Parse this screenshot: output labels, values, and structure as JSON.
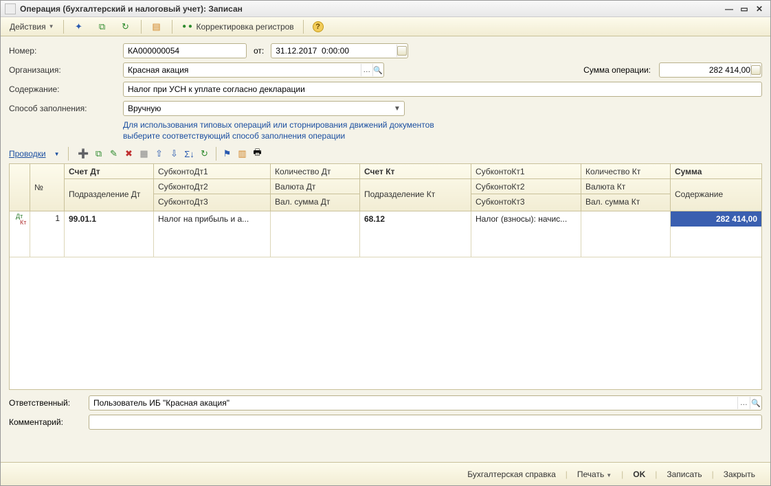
{
  "titlebar": {
    "title": "Операция (бухгалтерский и налоговый учет): Записан"
  },
  "toolbar": {
    "actions_label": "Действия",
    "reg_correction": "Корректировка регистров"
  },
  "form": {
    "number_label": "Номер:",
    "number_value": "КА000000054",
    "from_label": "от:",
    "date_value": "31.12.2017  0:00:00",
    "org_label": "Организация:",
    "org_value": "Красная акация",
    "sum_label": "Сумма операции:",
    "sum_value": "282 414,00",
    "content_label": "Содержание:",
    "content_value": "Налог при УСН к уплате согласно декларации",
    "fill_label": "Способ заполнения:",
    "fill_value": "Вручную",
    "hint_line1": "Для использования типовых операций или сторнирования движений документов",
    "hint_line2": "выберите соответствующий способ заполнения операции"
  },
  "tabs": {
    "entries": "Проводки"
  },
  "grid": {
    "headers": {
      "num": "№",
      "acc_dt": "Счет Дт",
      "dept_dt": "Подразделение Дт",
      "sub_dt1": "СубконтоДт1",
      "sub_dt2": "СубконтоДт2",
      "sub_dt3": "СубконтоДт3",
      "qty_dt": "Количество Дт",
      "cur_dt": "Валюта Дт",
      "cursum_dt": "Вал. сумма Дт",
      "acc_kt": "Счет Кт",
      "dept_kt": "Подразделение Кт",
      "sub_kt1": "СубконтоКт1",
      "sub_kt2": "СубконтоКт2",
      "sub_kt3": "СубконтоКт3",
      "qty_kt": "Количество Кт",
      "cur_kt": "Валюта Кт",
      "cursum_kt": "Вал. сумма Кт",
      "sum": "Сумма",
      "content": "Содержание"
    },
    "row1": {
      "num": "1",
      "acc_dt": "99.01.1",
      "sub_dt1": "Налог на прибыль и а...",
      "acc_kt": "68.12",
      "sub_kt1": "Налог (взносы): начис...",
      "sum": "282 414,00"
    },
    "dtkt": {
      "dt": "Дт",
      "kt": "Кт"
    }
  },
  "bottom": {
    "resp_label": "Ответственный:",
    "resp_value": "Пользователь ИБ \"Красная акация\"",
    "comment_label": "Комментарий:",
    "comment_value": ""
  },
  "footer": {
    "report": "Бухгалтерская справка",
    "print": "Печать",
    "ok": "OK",
    "save": "Записать",
    "close": "Закрыть"
  }
}
